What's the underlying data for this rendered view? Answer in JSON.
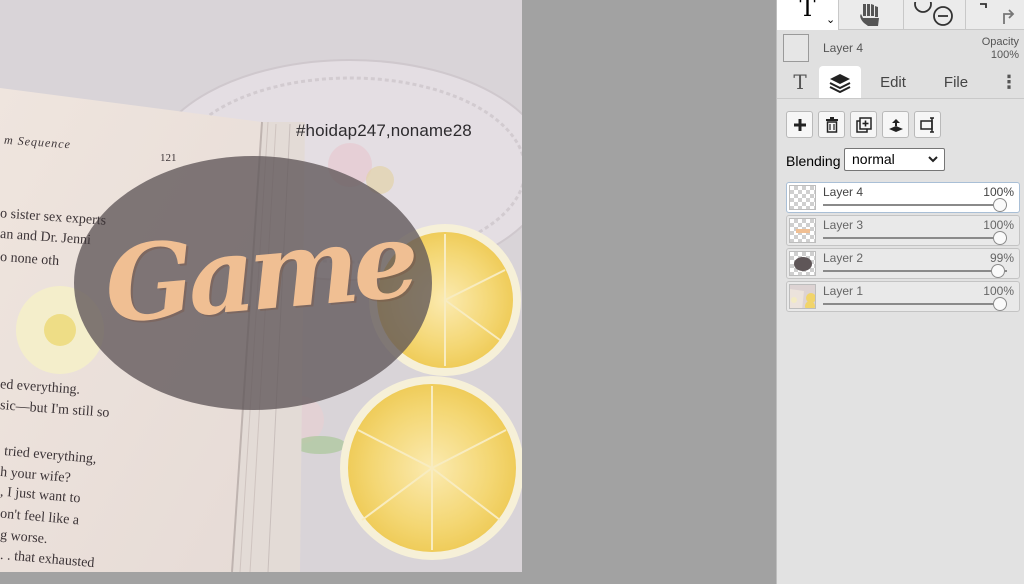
{
  "canvas": {
    "hashtag": "#hoidap247,noname28",
    "title_art": "Game",
    "book_lines": [
      "m Sequence",
      "121",
      "o sister sex experts",
      "an and Dr. Jenni",
      "o none oth",
      "ed everything.",
      "sic—but I'm still so",
      "tried everything,",
      "h your wife?",
      ", I just want to",
      "on't feel like a",
      "g worse.",
      ". . that exhausted"
    ]
  },
  "toolbar": {
    "type_tool": "T",
    "type_chevron": "⌄"
  },
  "layer_info": {
    "name": "Layer 4",
    "opacity_label": "Opacity",
    "opacity_value": "100%"
  },
  "tabs": {
    "text_tab": "T",
    "edit": "Edit",
    "file": "File",
    "more": "⋮"
  },
  "layers_panel": {
    "blending_label": "Blending",
    "blending_value": "normal",
    "layers": [
      {
        "name": "Layer 4",
        "opacity": "100%",
        "fraction": 1.0
      },
      {
        "name": "Layer 3",
        "opacity": "100%",
        "fraction": 1.0
      },
      {
        "name": "Layer 2",
        "opacity": "99%",
        "fraction": 0.99
      },
      {
        "name": "Layer 1",
        "opacity": "100%",
        "fraction": 1.0
      }
    ]
  },
  "colors": {
    "accent_border": "#a9bfd6",
    "title_art": "#f0bf93",
    "panel_bg": "#e0e0e0"
  },
  "icons": [
    "type-tool-icon",
    "hand-icon",
    "zoom-in-icon",
    "zoom-out-icon",
    "undo-icon",
    "redo-icon",
    "text-tab-icon",
    "layers-icon",
    "add-layer-icon",
    "delete-layer-icon",
    "duplicate-layer-icon",
    "merge-down-icon",
    "layer-properties-icon"
  ]
}
